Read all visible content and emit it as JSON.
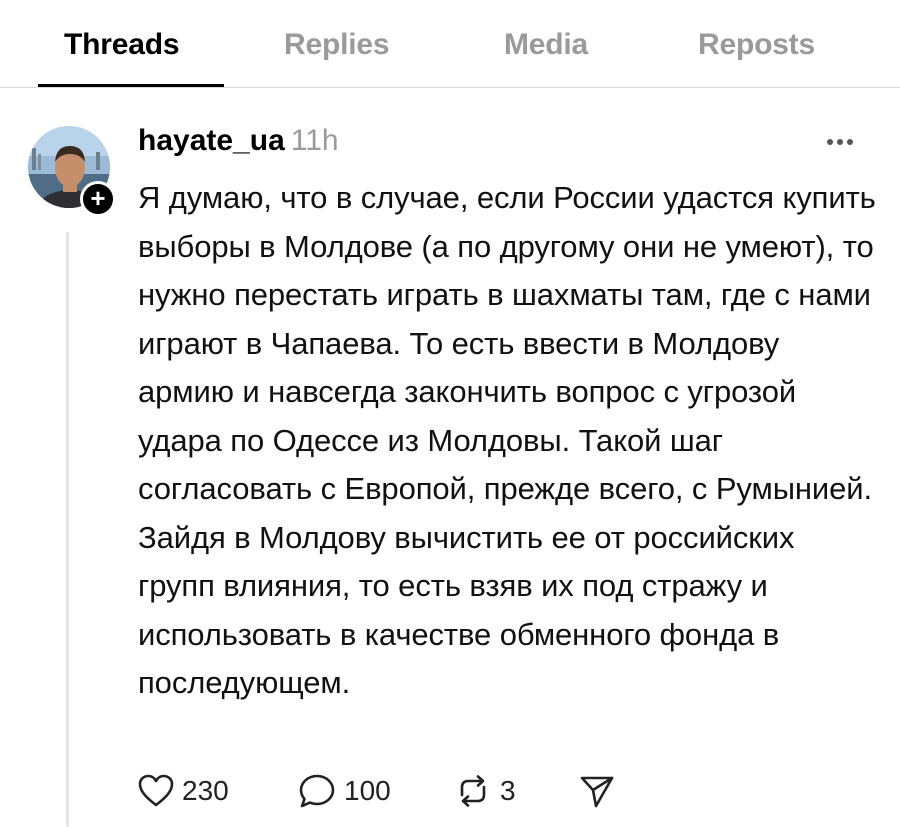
{
  "tabs": [
    {
      "label": "Threads",
      "active": true
    },
    {
      "label": "Replies",
      "active": false
    },
    {
      "label": "Media",
      "active": false
    },
    {
      "label": "Reposts",
      "active": false
    }
  ],
  "post": {
    "username": "hayate_ua",
    "time": "11h",
    "text": "Я думаю, что в случае, если России удастся купить выборы в Молдове (а по другому они не умеют), то нужно перестать играть в шахматы там, где с нами играют в Чапаева. То есть ввести в Молдову армию и навсегда закончить вопрос с угрозой удара по Одессе из Молдовы. Такой шаг согласовать с Европой, прежде всего, с Румынией. Зайдя в Молдову вычистить ее от российских групп влияния, то есть взяв их под стражу и использовать в качестве обменного фонда в последующем.",
    "likes": "230",
    "comments": "100",
    "reposts": "3"
  },
  "icons": {
    "more": "more-horizontal-icon",
    "like": "heart-icon",
    "comment": "comment-bubble-icon",
    "repost": "repost-icon",
    "share": "send-icon",
    "add": "plus-icon"
  },
  "colors": {
    "text": "#000000",
    "muted": "#9a9a9a",
    "divider": "#dbdbdb"
  }
}
